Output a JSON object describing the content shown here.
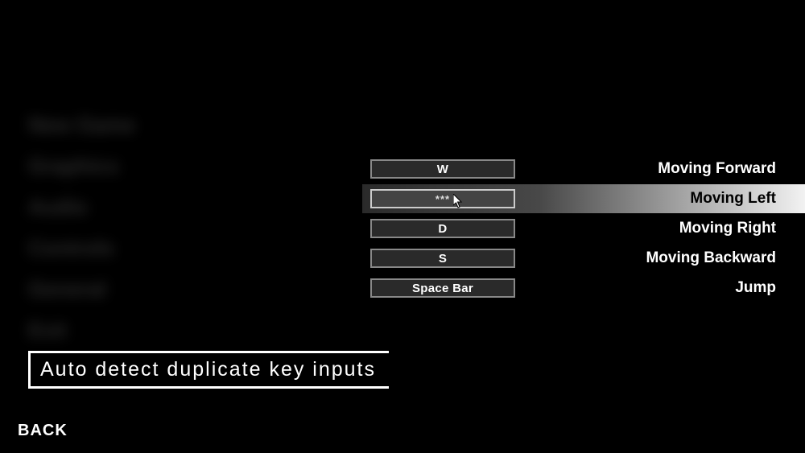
{
  "leftMenu": {
    "items": [
      "New Game",
      "Graphics",
      "Audio",
      "Controls",
      "General",
      "Exit"
    ]
  },
  "bindings": [
    {
      "key": "W",
      "action": "Moving Forward",
      "highlight": false
    },
    {
      "key": "***",
      "action": "Moving Left",
      "highlight": true
    },
    {
      "key": "D",
      "action": "Moving Right",
      "highlight": false
    },
    {
      "key": "S",
      "action": "Moving Backward",
      "highlight": false
    },
    {
      "key": "Space Bar",
      "action": "Jump",
      "highlight": false
    }
  ],
  "caption": "Auto detect duplicate key inputs",
  "back": "BACK"
}
